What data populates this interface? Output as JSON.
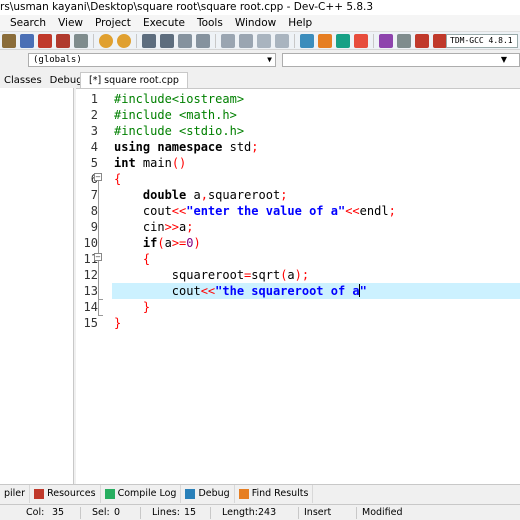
{
  "window": {
    "title": "rs\\usman kayani\\Desktop\\square root\\square root.cpp - Dev-C++ 5.8.3"
  },
  "menu": [
    "Search",
    "View",
    "Project",
    "Execute",
    "Tools",
    "Window",
    "Help"
  ],
  "toolbar": {
    "compiler": "TDM-GCC 4.8.1"
  },
  "scope": {
    "value": "(globals)"
  },
  "left_tabs": [
    "Classes",
    "Debug"
  ],
  "editor_tab": "[*] square root.cpp",
  "code_lines": [
    {
      "n": "1",
      "parts": [
        {
          "t": "#include<iostream>",
          "c": "pp"
        }
      ]
    },
    {
      "n": "2",
      "parts": [
        {
          "t": "#include <math.h>",
          "c": "pp"
        }
      ]
    },
    {
      "n": "3",
      "parts": [
        {
          "t": "#include <stdio.h>",
          "c": "pp"
        }
      ]
    },
    {
      "n": "4",
      "parts": [
        {
          "t": "using namespace",
          "c": "kw"
        },
        {
          "t": " std",
          "c": ""
        },
        {
          "t": ";",
          "c": "sy"
        }
      ]
    },
    {
      "n": "5",
      "parts": [
        {
          "t": "int",
          "c": "kw"
        },
        {
          "t": " main",
          "c": ""
        },
        {
          "t": "()",
          "c": "sy"
        }
      ]
    },
    {
      "n": "6",
      "parts": [
        {
          "t": "{",
          "c": "br"
        }
      ]
    },
    {
      "n": "7",
      "parts": [
        {
          "t": "    ",
          "c": ""
        },
        {
          "t": "double",
          "c": "kw"
        },
        {
          "t": " a",
          "c": ""
        },
        {
          "t": ",",
          "c": "sy"
        },
        {
          "t": "squareroot",
          "c": ""
        },
        {
          "t": ";",
          "c": "sy"
        }
      ]
    },
    {
      "n": "8",
      "parts": [
        {
          "t": "    cout",
          "c": ""
        },
        {
          "t": "<<",
          "c": "sy"
        },
        {
          "t": "\"enter the value of a\"",
          "c": "st"
        },
        {
          "t": "<<",
          "c": "sy"
        },
        {
          "t": "endl",
          "c": ""
        },
        {
          "t": ";",
          "c": "sy"
        }
      ]
    },
    {
      "n": "9",
      "parts": [
        {
          "t": "    cin",
          "c": ""
        },
        {
          "t": ">>",
          "c": "sy"
        },
        {
          "t": "a",
          "c": ""
        },
        {
          "t": ";",
          "c": "sy"
        }
      ]
    },
    {
      "n": "10",
      "parts": [
        {
          "t": "    ",
          "c": ""
        },
        {
          "t": "if",
          "c": "kw"
        },
        {
          "t": "(",
          "c": "sy"
        },
        {
          "t": "a",
          "c": ""
        },
        {
          "t": ">=",
          "c": "sy"
        },
        {
          "t": "0",
          "c": "nm"
        },
        {
          "t": ")",
          "c": "sy"
        }
      ]
    },
    {
      "n": "11",
      "parts": [
        {
          "t": "    ",
          "c": ""
        },
        {
          "t": "{",
          "c": "br"
        }
      ]
    },
    {
      "n": "12",
      "parts": [
        {
          "t": "        squareroot",
          "c": ""
        },
        {
          "t": "=",
          "c": "sy"
        },
        {
          "t": "sqrt",
          "c": ""
        },
        {
          "t": "(",
          "c": "sy"
        },
        {
          "t": "a",
          "c": ""
        },
        {
          "t": ");",
          "c": "sy"
        }
      ]
    },
    {
      "n": "13",
      "parts": [
        {
          "t": "        cout",
          "c": ""
        },
        {
          "t": "<<",
          "c": "sy"
        },
        {
          "t": "\"the squareroot of a\"",
          "c": "st"
        }
      ]
    },
    {
      "n": "14",
      "parts": [
        {
          "t": "    ",
          "c": ""
        },
        {
          "t": "}",
          "c": "br"
        }
      ]
    },
    {
      "n": "15",
      "parts": [
        {
          "t": "}",
          "c": "br"
        }
      ]
    }
  ],
  "bottom_tabs": [
    "piler",
    "Resources",
    "Compile Log",
    "Debug",
    "Find Results"
  ],
  "status": {
    "col_label": "Col:",
    "col": "35",
    "sel_label": "Sel:",
    "sel": "0",
    "lines_label": "Lines:",
    "lines": "15",
    "length_label": "Length:",
    "length": "243",
    "mode": "Insert",
    "state": "Modified"
  }
}
